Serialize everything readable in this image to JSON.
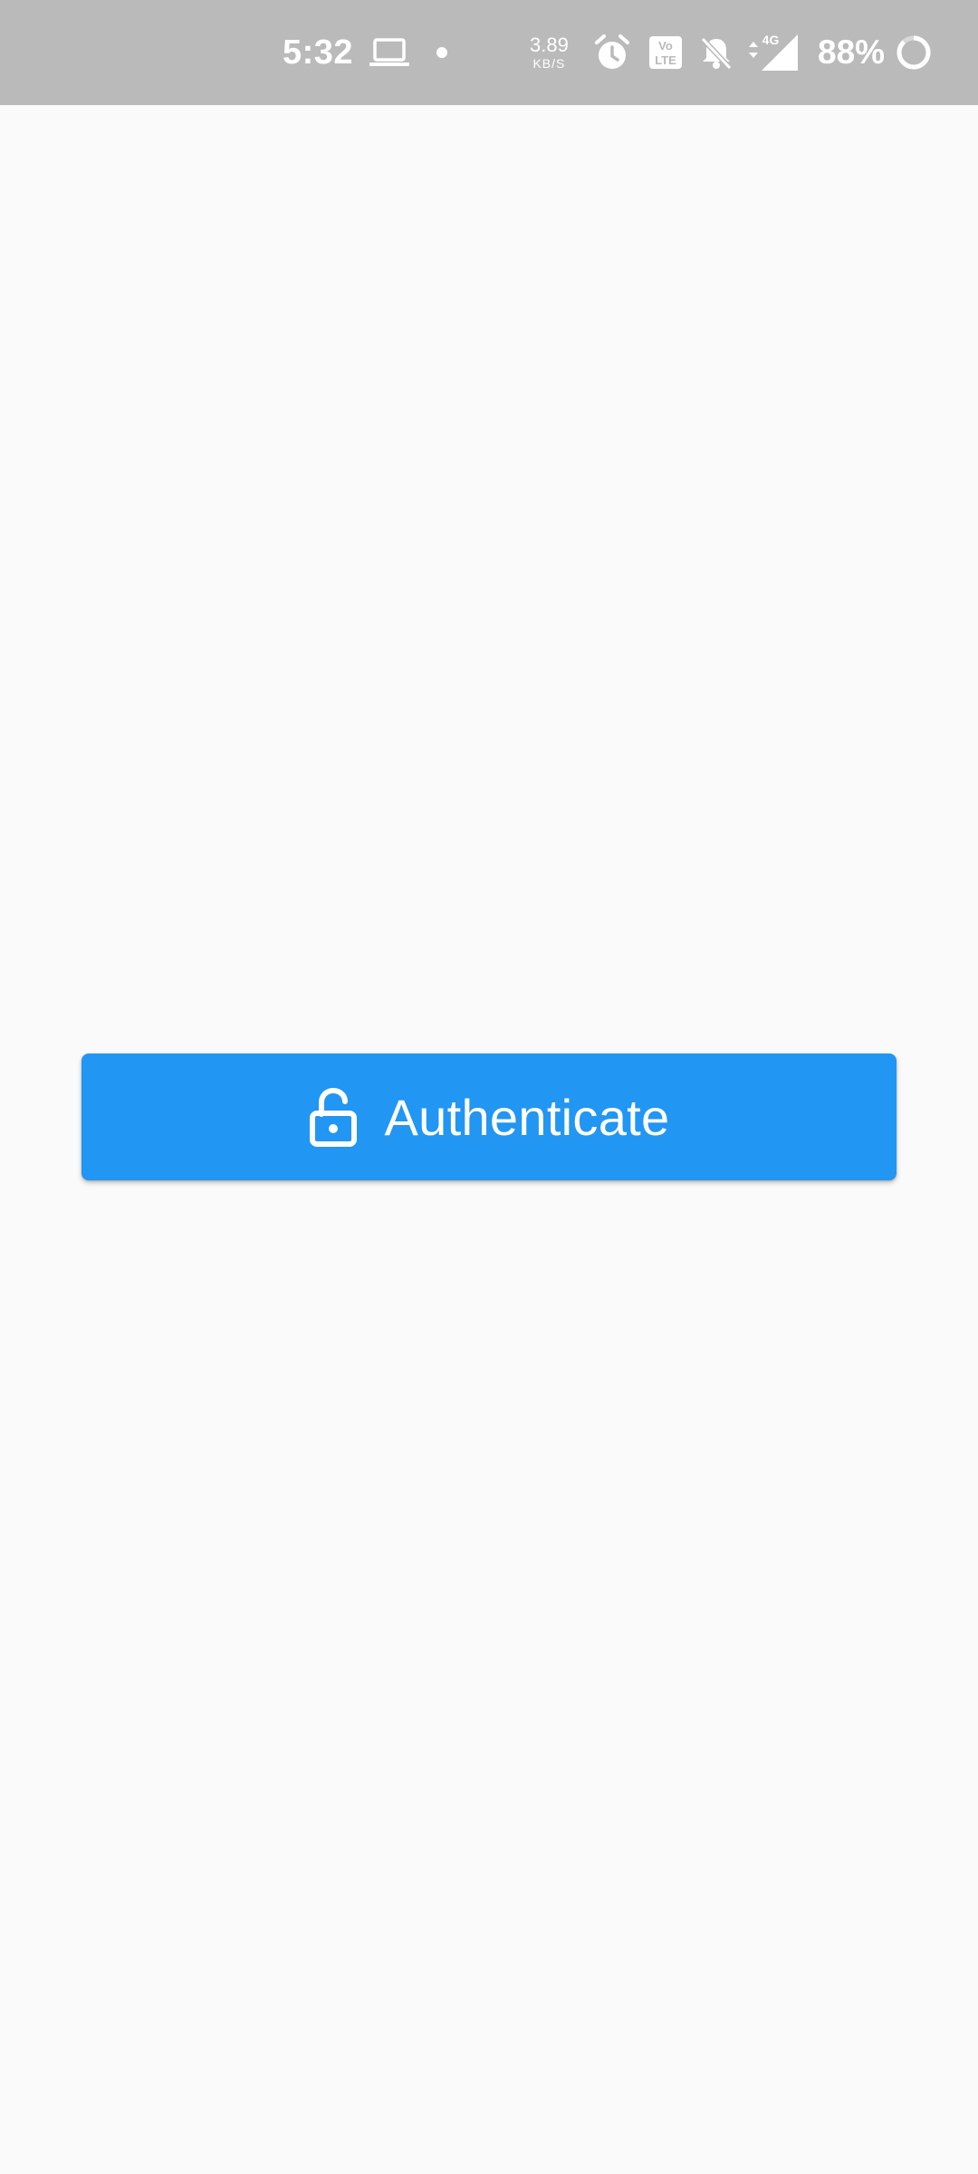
{
  "status_bar": {
    "time": "5:32",
    "net_speed_value": "3.89",
    "net_speed_unit": "KB/S",
    "network_type": "4G",
    "battery_percent": "88%",
    "icons": [
      "laptop-icon",
      "notification-dot-icon",
      "alarm-icon",
      "volte-icon",
      "bell-off-icon",
      "signal-4g-icon",
      "battery-ring-icon"
    ]
  },
  "main": {
    "authenticate_button": {
      "label": "Authenticate",
      "icon": "lock-open-icon",
      "color": "#2196f3"
    }
  }
}
